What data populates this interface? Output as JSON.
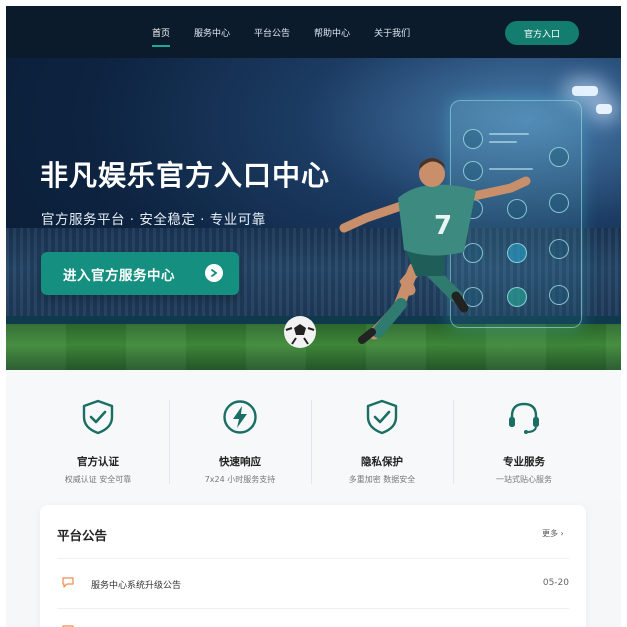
{
  "nav": {
    "items": [
      {
        "label": "首页",
        "active": true
      },
      {
        "label": "服务中心"
      },
      {
        "label": "平台公告"
      },
      {
        "label": "帮助中心"
      },
      {
        "label": "关于我们"
      }
    ],
    "cta": "官方入口"
  },
  "hero": {
    "title": "非凡娱乐官方入口中心",
    "subtitle": "官方服务平台 · 安全稳定 · 专业可靠",
    "button": "进入官方服务中心",
    "player_number": "7"
  },
  "features": [
    {
      "icon": "shield-check-icon",
      "title": "官方认证",
      "desc": "权威认证 安全可靠"
    },
    {
      "icon": "lightning-icon",
      "title": "快速响应",
      "desc": "7x24 小时服务支持"
    },
    {
      "icon": "shield-check-icon",
      "title": "隐私保护",
      "desc": "多重加密 数据安全"
    },
    {
      "icon": "headset-icon",
      "title": "专业服务",
      "desc": "一站式贴心服务"
    }
  ],
  "announcements": {
    "title": "平台公告",
    "more": "更多 ›",
    "items": [
      {
        "text": "服务中心系统升级公告",
        "date": "05-20"
      },
      {
        "text": "",
        "date": ""
      }
    ]
  },
  "colors": {
    "accent": "#137d70",
    "header_bg": "#0c1b2c",
    "icon_green": "#1a6e64",
    "bubble_orange": "#f08a4b"
  }
}
